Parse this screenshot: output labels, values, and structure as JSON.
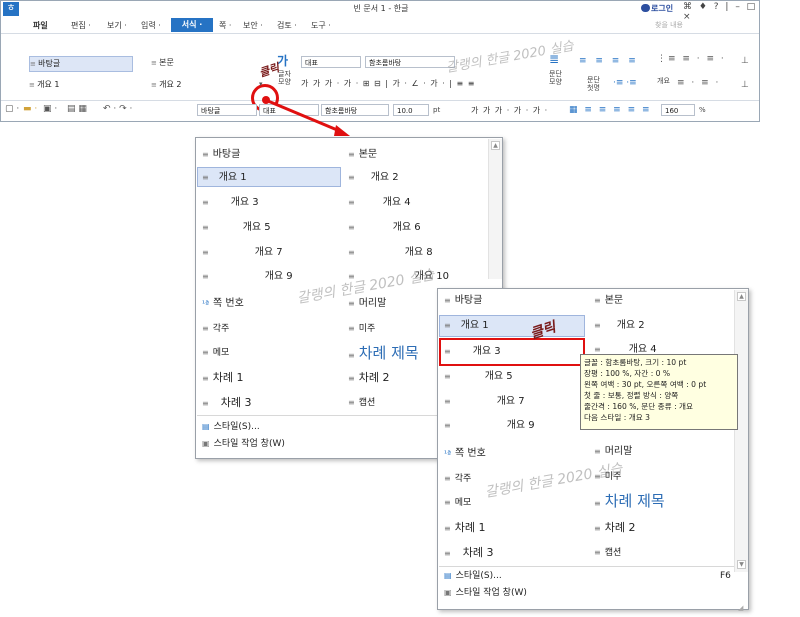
{
  "window": {
    "title": "빈 문서 1 - 한글",
    "login": "로그인",
    "controls": "⌘ ♦ ?  |  –  □  ×"
  },
  "menubar": {
    "items": [
      "파일",
      "편집 ·",
      "보기 ·",
      "입력 ·",
      "서식 ·",
      "쪽 ·",
      "보안 ·",
      "검토 ·",
      "도구 ·"
    ],
    "selected": "서식 ·",
    "search_placeholder": "찾을 내용"
  },
  "ribbon": {
    "styles": [
      "바탕글",
      "본문",
      "개요 1",
      "개요 2"
    ],
    "char_label": "글자\n모양",
    "style_box": "대표",
    "font_box": "함초롬바탕",
    "para_label": "문단\n모양",
    "para_style_label": "문단\n첫명",
    "outline_label": "개요"
  },
  "toolbar2": {
    "style_box": "바탕글",
    "lang_box": "대표",
    "font_box": "함초롬바탕",
    "size_box": "10.0",
    "size_unit": "pt",
    "zoom_box": "160",
    "zoom_unit": "%"
  },
  "dropdown_left": {
    "items": [
      {
        "label": "바탕글"
      },
      {
        "label": "본문"
      },
      {
        "label": "개요 1"
      },
      {
        "label": "개요 2"
      },
      {
        "label": "개요 3"
      },
      {
        "label": "개요 4"
      },
      {
        "label": "개요 5"
      },
      {
        "label": "개요 6"
      },
      {
        "label": "개요 7"
      },
      {
        "label": "개요 8"
      },
      {
        "label": "개요 9"
      },
      {
        "label": "개요 10"
      },
      {
        "label": "쪽 번호"
      },
      {
        "label": "머리말"
      },
      {
        "label": "각주"
      },
      {
        "label": "미주"
      },
      {
        "label": "메모"
      },
      {
        "label": "차례 제목"
      },
      {
        "label": "차례 1"
      },
      {
        "label": "차례 2"
      },
      {
        "label": "차례 3"
      },
      {
        "label": "캡션"
      }
    ],
    "footer": [
      "스타일(S)...",
      "스타일 작업 창(W)"
    ]
  },
  "dropdown_right": {
    "items": [
      {
        "label": "바탕글"
      },
      {
        "label": "본문"
      },
      {
        "label": "개요 1"
      },
      {
        "label": "개요 2"
      },
      {
        "label": "개요 3"
      },
      {
        "label": "개요 4"
      },
      {
        "label": "개요 5"
      },
      {
        "label": "개요 7"
      },
      {
        "label": "개요 9"
      },
      {
        "label": "쪽 번호"
      },
      {
        "label": "머리말"
      },
      {
        "label": "각주"
      },
      {
        "label": "미주"
      },
      {
        "label": "메모"
      },
      {
        "label": "차례 제목"
      },
      {
        "label": "차례 1"
      },
      {
        "label": "차례 2"
      },
      {
        "label": "차례 3"
      },
      {
        "label": "캡션"
      }
    ],
    "footer": [
      "스타일(S)...",
      "스타일 작업 창(W)"
    ],
    "shortcut": "F6"
  },
  "tooltip": {
    "lines": [
      "글꼴 : 함초롬바탕, 크기 : 10 pt",
      "장평 : 100 %, 자간 : 0 %",
      "왼쪽 여백 : 30 pt, 오른쪽 여백 : 0 pt",
      "첫 줄 : 보통, 정렬 방식 : 양쪽",
      "줄간격 : 160 %, 문단 종류 : 개요",
      "다음 스타일 : 개요 3"
    ]
  },
  "watermark": "갈랭의 한글 2020 실습",
  "sticker": "클릭",
  "colors": {
    "accent": "#2673c4",
    "highlight": "#e01010",
    "title_blue": "#2d6db5"
  }
}
